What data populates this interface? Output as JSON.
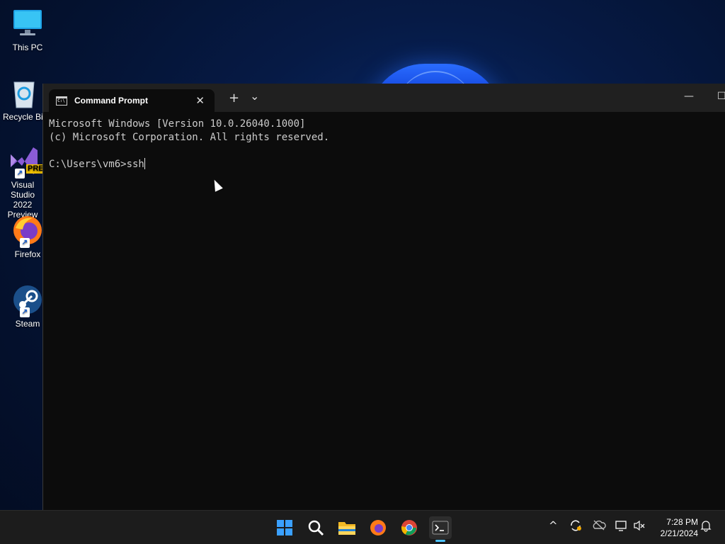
{
  "desktop": {
    "icons": [
      {
        "label": "This PC"
      },
      {
        "label": "Recycle Bin"
      },
      {
        "label": "Visual Studio 2022 Preview",
        "badge": "PRE"
      },
      {
        "label": "Firefox"
      },
      {
        "label": "Steam"
      }
    ]
  },
  "window": {
    "tab_title": "Command Prompt",
    "tab_close": "✕",
    "new_tab": "+",
    "dropdown": "⌄",
    "minimize": "—",
    "maximize": "☐"
  },
  "console": {
    "line1": "Microsoft Windows [Version 10.0.26040.1000]",
    "line2": "(c) Microsoft Corporation. All rights reserved.",
    "prompt": "C:\\Users\\vm6>",
    "input": "ssh"
  },
  "taskbar": {
    "apps": [
      "start-icon",
      "search-icon",
      "file-explorer-icon",
      "firefox-icon",
      "chrome-icon",
      "terminal-icon"
    ],
    "tray": {
      "chevron": "^"
    },
    "time": "7:28 PM",
    "date": "2/21/2024"
  },
  "colors": {
    "accent": "#4cc2ff",
    "console_bg": "#0c0c0c",
    "titlebar_bg": "#202020",
    "taskbar_bg": "#1c1c1c"
  }
}
